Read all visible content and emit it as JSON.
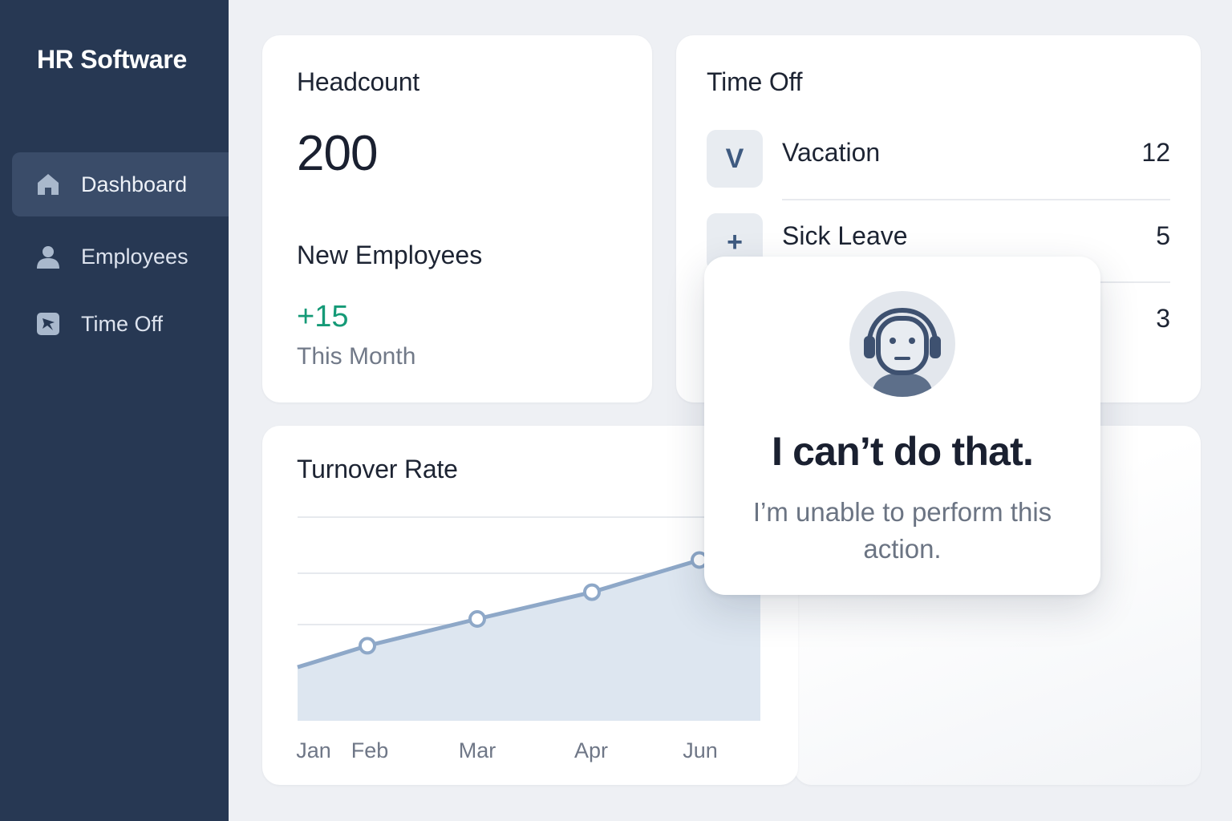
{
  "app": {
    "title": "HR Software"
  },
  "sidebar": {
    "items": [
      {
        "label": "Dashboard",
        "icon": "home-icon",
        "active": true
      },
      {
        "label": "Employees",
        "icon": "user-icon",
        "active": false
      },
      {
        "label": "Time Off",
        "icon": "plane-icon",
        "active": false
      }
    ]
  },
  "headcount": {
    "title": "Headcount",
    "value": "200",
    "new_employees_title": "New Employees",
    "new_employees_value": "+15",
    "new_employees_period": "This Month"
  },
  "time_off": {
    "title": "Time Off",
    "rows": [
      {
        "badge": "V",
        "label": "Vacation",
        "count": "12"
      },
      {
        "badge": "+",
        "label": "Sick Leave",
        "count": "5"
      },
      {
        "badge": "",
        "label": "",
        "count": "3"
      }
    ]
  },
  "turnover": {
    "title": "Turnover Rate"
  },
  "chart_data": {
    "type": "area",
    "title": "Turnover Rate",
    "categories": [
      "Jan",
      "Feb",
      "Mar",
      "Apr",
      "Jun"
    ],
    "series": [
      {
        "values": [
          1.0,
          1.4,
          1.9,
          2.4,
          3.0
        ]
      }
    ],
    "ylim": [
      0,
      3.8
    ],
    "grid": true,
    "legend": "none"
  },
  "modal": {
    "title": "I can’t do that.",
    "message": "I’m unable to perform this action."
  },
  "colors": {
    "sidebar_bg": "#273853",
    "sidebar_active": "#3a4c69",
    "accent_green": "#159a77",
    "chart_line": "#8ea8c8",
    "chart_fill": "#dde6f0"
  }
}
